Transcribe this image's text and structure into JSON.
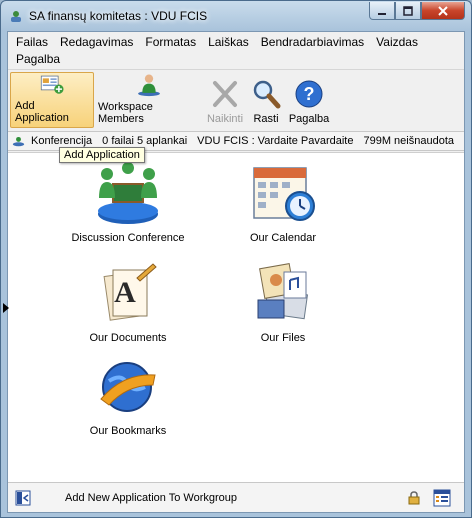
{
  "window": {
    "title": "SA finansų komitetas : VDU FCIS"
  },
  "menu": [
    {
      "label": "Failas"
    },
    {
      "label": "Redagavimas"
    },
    {
      "label": "Formatas"
    },
    {
      "label": "Laiškas"
    },
    {
      "label": "Bendradarbiavimas"
    },
    {
      "label": "Vaizdas"
    },
    {
      "label": "Pagalba"
    }
  ],
  "toolbar": {
    "add_application": "Add Application",
    "workspace_members": "Workspace Members",
    "naikinti": "Naikinti",
    "rasti": "Rasti",
    "pagalba": "Pagalba"
  },
  "status": {
    "location": "Konferencija",
    "counts": "0 failai 5 aplankai",
    "user": "VDU FCIS : Vardaite Pavardaite",
    "storage": "799M neišnaudota"
  },
  "tooltip": "Add Application",
  "apps": {
    "discussion": "Discussion Conference",
    "calendar": "Our Calendar",
    "documents": "Our Documents",
    "files": "Our Files",
    "bookmarks": "Our Bookmarks"
  },
  "bottom": {
    "label": "Add New Application To Workgroup"
  },
  "colors": {
    "active_toolbar": "#f7d27a",
    "titlebar": "#a9c3db",
    "close_button": "#c9452b"
  }
}
